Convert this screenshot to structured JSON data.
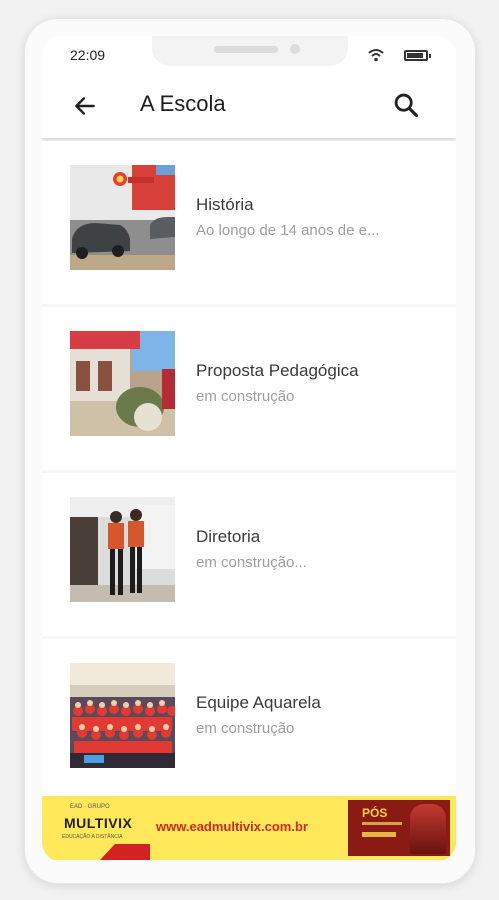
{
  "statusbar": {
    "time": "22:09",
    "icons": [
      "wifi-icon",
      "battery-icon"
    ]
  },
  "appbar": {
    "title": "A Escola",
    "back_icon": "arrow-left-icon",
    "search_icon": "search-icon"
  },
  "items": [
    {
      "title": "História",
      "subtitle": "Ao longo de 14 anos de e..."
    },
    {
      "title": "Proposta Pedagógica",
      "subtitle": "em construção"
    },
    {
      "title": "Diretoria",
      "subtitle": "em construção..."
    },
    {
      "title": "Equipe Aquarela",
      "subtitle": "em construção"
    }
  ],
  "banner": {
    "brand": "MULTIVIX",
    "url": "www.eadmultivix.com.br",
    "promo": "PÓS"
  },
  "colors": {
    "banner_bg": "#ffe85a",
    "url_red": "#d02a2a",
    "promo_bg": "#8a1a14"
  }
}
